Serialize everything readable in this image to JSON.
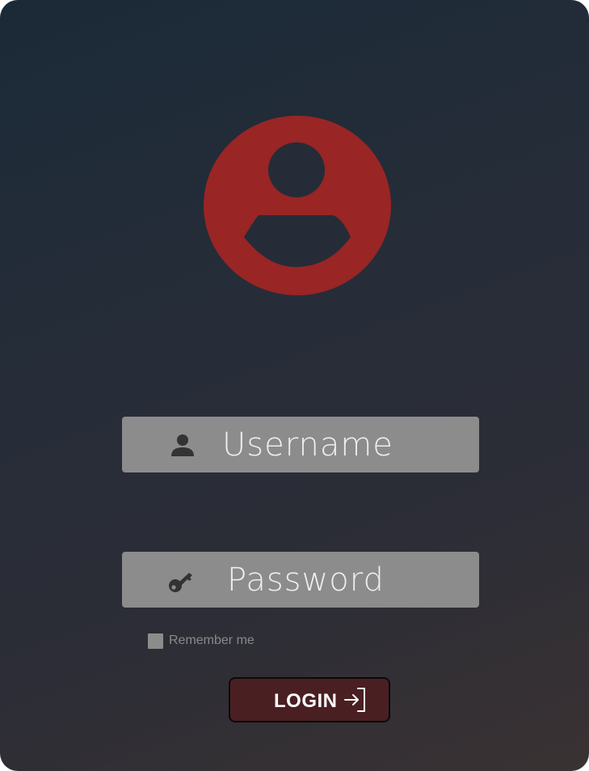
{
  "username": {
    "placeholder": "Username",
    "icon": "user-icon"
  },
  "password": {
    "placeholder": "Password",
    "icon": "key-icon"
  },
  "remember": {
    "label": "Remember me",
    "checked": false
  },
  "login": {
    "label": "LOGIN",
    "icon": "sign-in-arrow-icon"
  },
  "avatar": {
    "icon": "user-avatar-icon",
    "color": "#992525"
  },
  "colors": {
    "field_bg": "#8c8c8c",
    "button_bg": "#4a1f22",
    "background_start": "#1b2a38",
    "background_end": "#3a3233"
  }
}
